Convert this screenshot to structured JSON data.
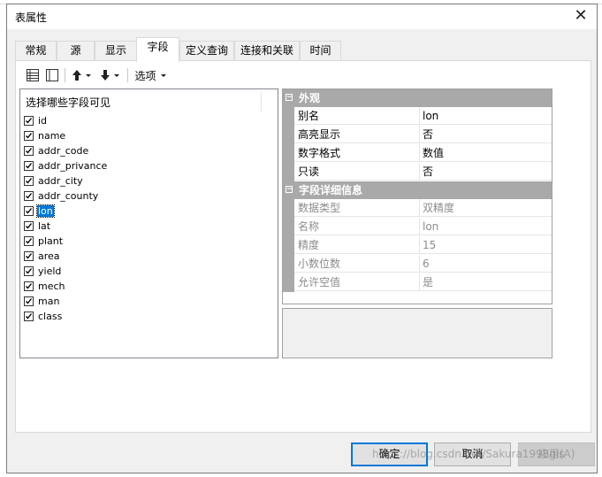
{
  "window": {
    "title": "表属性",
    "close_label": "✕"
  },
  "tabs": [
    {
      "label": "常规",
      "active": false
    },
    {
      "label": "源",
      "active": false
    },
    {
      "label": "显示",
      "active": false
    },
    {
      "label": "字段",
      "active": true
    },
    {
      "label": "定义查询",
      "active": false
    },
    {
      "label": "连接和关联",
      "active": false
    },
    {
      "label": "时间",
      "active": false
    }
  ],
  "toolbar": {
    "options_label": "选项",
    "icons": [
      "grid-view-icon",
      "list-view-icon",
      "arrow-up-icon",
      "arrow-down-icon"
    ]
  },
  "field_list": {
    "header": "选择哪些字段可见",
    "items": [
      {
        "label": "id",
        "checked": true,
        "selected": false
      },
      {
        "label": "name",
        "checked": true,
        "selected": false
      },
      {
        "label": "addr_code",
        "checked": true,
        "selected": false
      },
      {
        "label": "addr_privance",
        "checked": true,
        "selected": false
      },
      {
        "label": "addr_city",
        "checked": true,
        "selected": false
      },
      {
        "label": "addr_county",
        "checked": true,
        "selected": false
      },
      {
        "label": "lon",
        "checked": true,
        "selected": true
      },
      {
        "label": "lat",
        "checked": true,
        "selected": false
      },
      {
        "label": "plant",
        "checked": true,
        "selected": false
      },
      {
        "label": "area",
        "checked": true,
        "selected": false
      },
      {
        "label": "yield",
        "checked": true,
        "selected": false
      },
      {
        "label": "mech",
        "checked": true,
        "selected": false
      },
      {
        "label": "man",
        "checked": true,
        "selected": false
      },
      {
        "label": "class",
        "checked": true,
        "selected": false
      }
    ]
  },
  "property_grid": {
    "categories": [
      {
        "name": "外观",
        "toggle": "⊟",
        "rows": [
          {
            "name": "别名",
            "value": "lon",
            "dim": false
          },
          {
            "name": "高亮显示",
            "value": "否",
            "dim": false
          },
          {
            "name": "数字格式",
            "value": "数值",
            "dim": false
          },
          {
            "name": "只读",
            "value": "否",
            "dim": false
          }
        ]
      },
      {
        "name": "字段详细信息",
        "toggle": "⊟",
        "rows": [
          {
            "name": "数据类型",
            "value": "双精度",
            "dim": true
          },
          {
            "name": "名称",
            "value": "lon",
            "dim": true
          },
          {
            "name": "精度",
            "value": "15",
            "dim": true
          },
          {
            "name": "小数位数",
            "value": "6",
            "dim": true
          },
          {
            "name": "允许空值",
            "value": "是",
            "dim": true
          }
        ]
      }
    ]
  },
  "buttons": {
    "ok": "确定",
    "cancel": "取消",
    "apply": "应用(A)"
  },
  "watermark": "https://blog.csdn.net/Sakura1998gis",
  "colors": {
    "selection": "#0078d7",
    "category_bg": "#a9a9a9",
    "dim_text": "#8c8c8c"
  }
}
